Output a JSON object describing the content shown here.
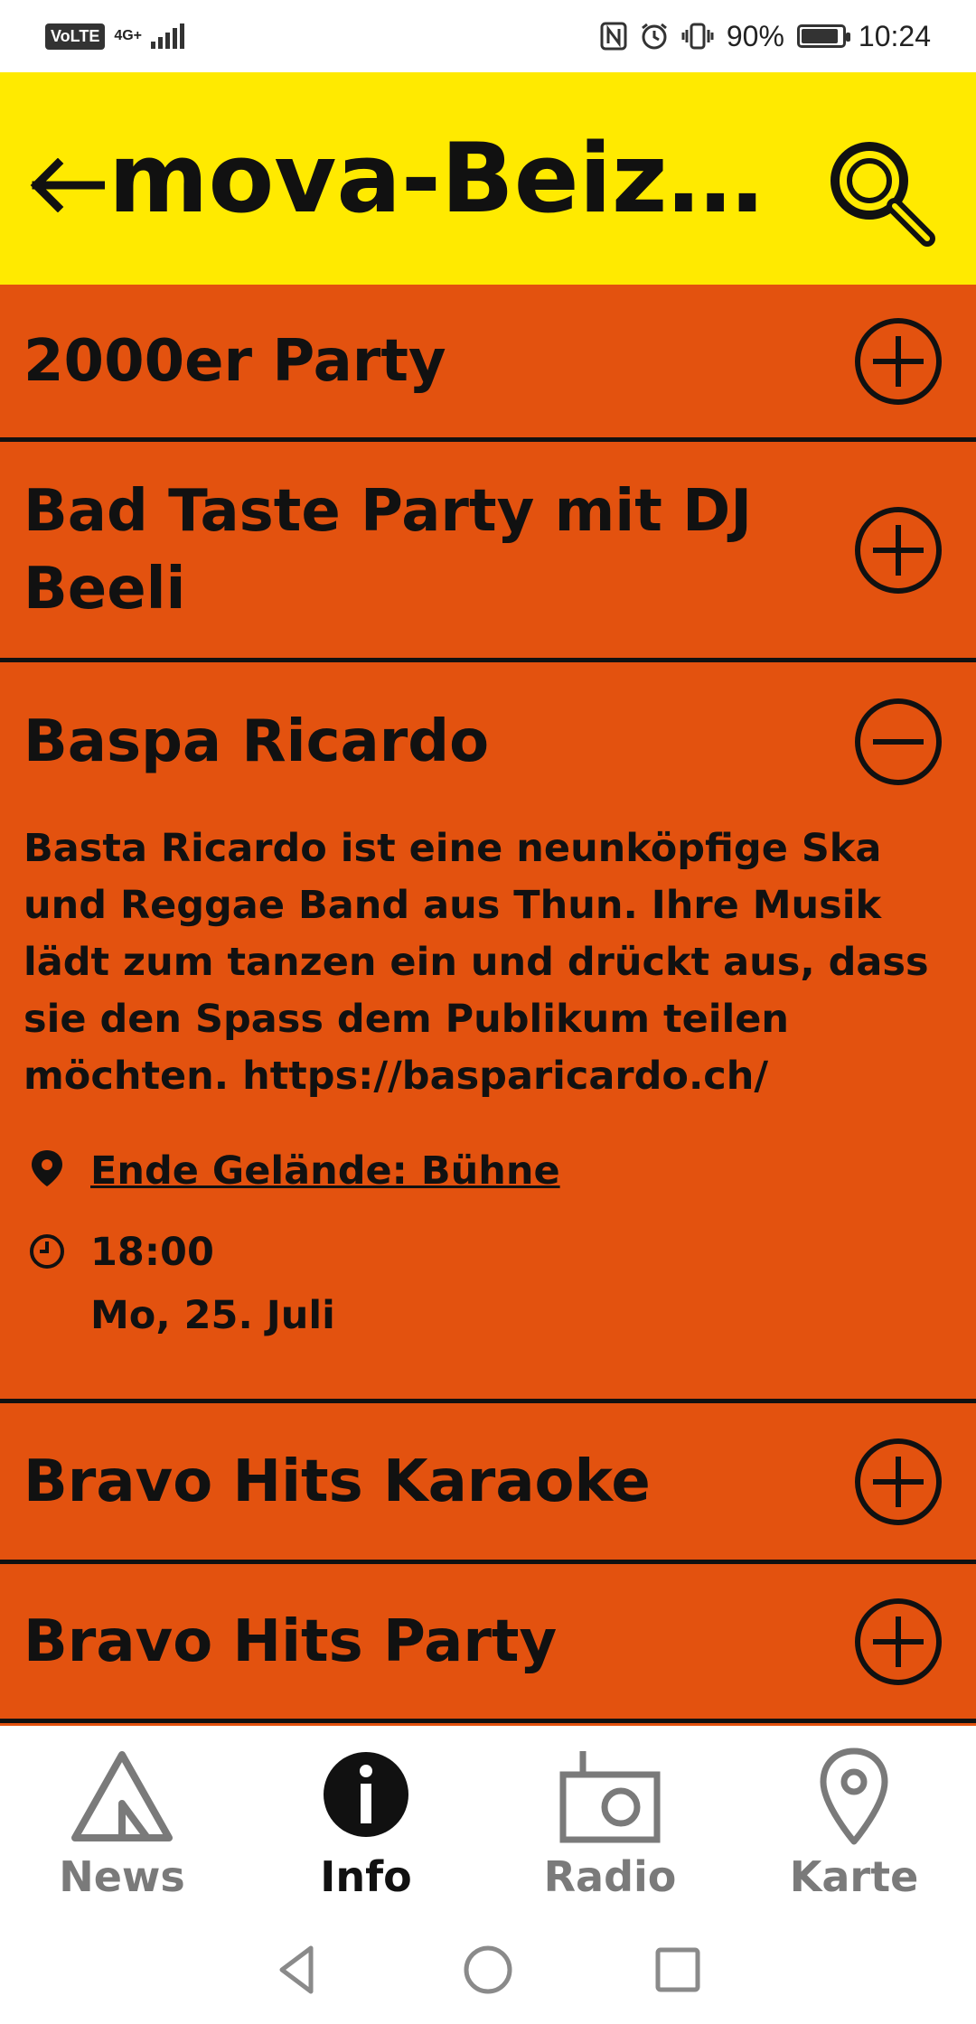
{
  "status_bar": {
    "volte": "VoLTE",
    "network": "4G+",
    "battery_percent": "90%",
    "battery_level": 0.9,
    "time": "10:24"
  },
  "header": {
    "title": "mova-Beize...",
    "back_icon": "arrow-left-icon",
    "search_icon": "magnifier-icon",
    "background_color": "#ffea00"
  },
  "list": {
    "background_color": "#e3520f",
    "items": [
      {
        "title": "2000er Party",
        "expanded": false,
        "toggle_icon": "plus-circle-icon"
      },
      {
        "title": "Bad Taste Party mit DJ Beeli",
        "expanded": false,
        "toggle_icon": "plus-circle-icon"
      },
      {
        "title": "Baspa Ricardo",
        "expanded": true,
        "toggle_icon": "minus-circle-icon",
        "description": "Basta Ricardo ist eine neunköpfige Ska und Reggae Band aus Thun. Ihre Musik lädt zum tanzen ein und drückt aus, dass sie den Spass dem Publikum teilen möchten. https://basparicardo.ch/",
        "location": "Ende Gelände: Bühne",
        "time": "18:00",
        "date": "Mo, 25. Juli"
      },
      {
        "title": "Bravo Hits Karaoke",
        "expanded": false,
        "toggle_icon": "plus-circle-icon"
      },
      {
        "title": "Bravo Hits Party",
        "expanded": false,
        "toggle_icon": "plus-circle-icon"
      }
    ]
  },
  "bottom_nav": {
    "items": [
      {
        "label": "News",
        "icon": "tent-icon",
        "active": false
      },
      {
        "label": "Info",
        "icon": "info-icon",
        "active": true
      },
      {
        "label": "Radio",
        "icon": "radio-icon",
        "active": false
      },
      {
        "label": "Karte",
        "icon": "map-pin-icon",
        "active": false
      }
    ]
  }
}
